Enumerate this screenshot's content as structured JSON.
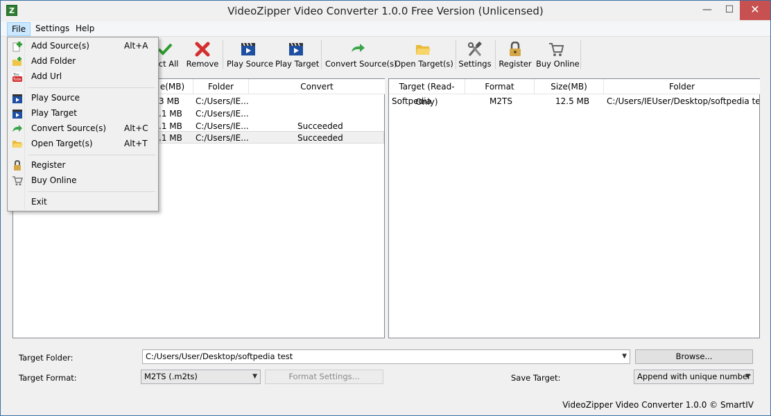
{
  "window": {
    "title": "VideoZipper Video Converter 1.0.0 Free Version (Unlicensed)",
    "controls": {
      "minimize": "—",
      "maximize": "☐",
      "close": "✕"
    }
  },
  "menubar": {
    "file": "File",
    "settings": "Settings",
    "help": "Help"
  },
  "toolbar": {
    "select_all": "lect All",
    "remove": "Remove",
    "play_source": "Play Source",
    "play_target": "Play Target",
    "convert_source": "Convert Source(s)",
    "open_target": "Open Target(s)",
    "settings": "Settings",
    "register": "Register",
    "buy_online": "Buy Online"
  },
  "file_menu": {
    "items": [
      {
        "label": "Add Source(s)",
        "shortcut": "Alt+A",
        "icon": "add-green-plus-icon"
      },
      {
        "label": "Add Folder",
        "shortcut": "",
        "icon": "add-folder-icon"
      },
      {
        "label": "Add Url",
        "shortcut": "",
        "icon": "youtube-icon"
      },
      {
        "label": "Play Source",
        "shortcut": "",
        "icon": "film-clapper-icon"
      },
      {
        "label": "Play Target",
        "shortcut": "",
        "icon": "film-clapper-icon"
      },
      {
        "label": "Convert Source(s)",
        "shortcut": "Alt+C",
        "icon": "green-arrow-icon"
      },
      {
        "label": "Open Target(s)",
        "shortcut": "Alt+T",
        "icon": "folder-open-icon"
      },
      {
        "label": "Register",
        "shortcut": "",
        "icon": "lock-icon"
      },
      {
        "label": "Buy Online",
        "shortcut": "",
        "icon": "cart-icon"
      },
      {
        "label": "Exit",
        "shortcut": "",
        "icon": ""
      }
    ]
  },
  "source_table": {
    "headers": {
      "size": "e(MB)",
      "folder": "Folder",
      "convert": "Convert"
    },
    "rows": [
      {
        "size": "3 MB",
        "folder": "C:/Users/IE...",
        "convert": ""
      },
      {
        "size": ".1 MB",
        "folder": "C:/Users/IE...",
        "convert": ""
      },
      {
        "size": ".1 MB",
        "folder": "C:/Users/IE...",
        "convert": "Succeeded"
      },
      {
        "size": ".1 MB",
        "folder": "C:/Users/IE...",
        "convert": "Succeeded"
      }
    ]
  },
  "target_table": {
    "headers": {
      "target": "Target (Read-Only)",
      "format": "Format",
      "size": "Size(MB)",
      "folder": "Folder"
    },
    "rows": [
      {
        "target": "Softpedia",
        "format": "M2TS",
        "size": "12.5 MB",
        "folder": "C:/Users/IEUser/Desktop/softpedia test"
      }
    ]
  },
  "options": {
    "target_folder_label": "Target Folder:",
    "target_folder_value": "C:/Users/User/Desktop/softpedia test",
    "browse_label": "Browse...",
    "target_format_label": "Target Format:",
    "target_format_value": "M2TS (.m2ts)",
    "format_settings_label": "Format Settings...",
    "save_target_label": "Save Target:",
    "save_target_value": "Append with unique number"
  },
  "status": {
    "text": "VideoZipper Video Converter 1.0.0 © SmartIV"
  }
}
